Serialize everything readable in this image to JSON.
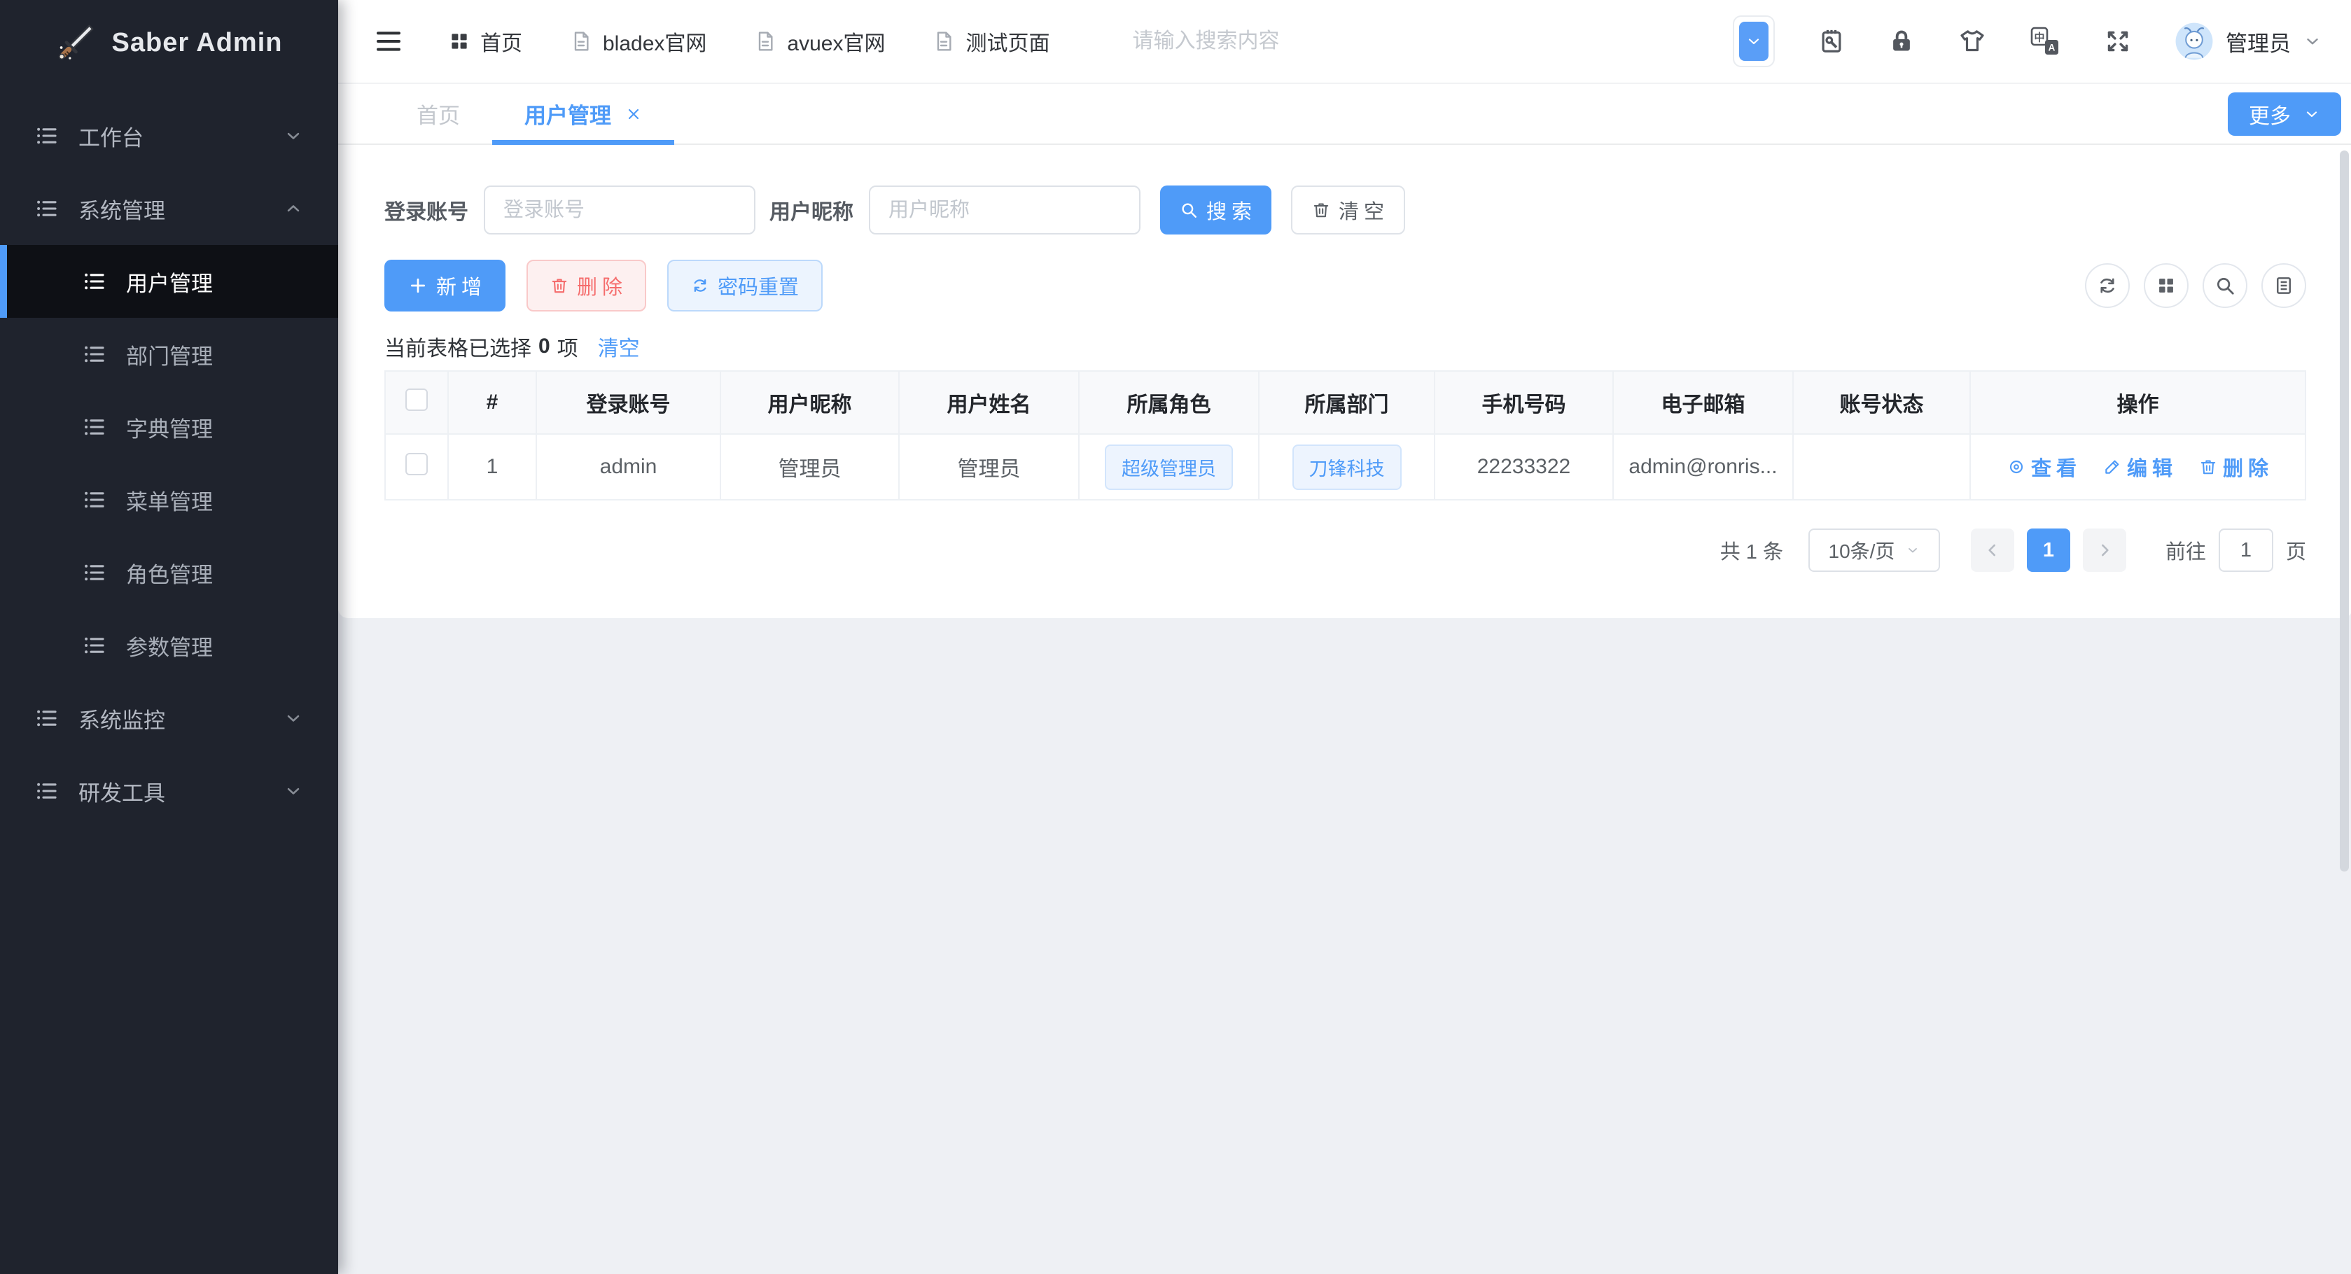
{
  "app": {
    "title": "Saber Admin"
  },
  "sidebar": {
    "groups": [
      {
        "label": "工作台",
        "state": "collapsed"
      },
      {
        "label": "系统管理",
        "state": "expanded",
        "children": [
          {
            "label": "用户管理",
            "active": true
          },
          {
            "label": "部门管理"
          },
          {
            "label": "字典管理"
          },
          {
            "label": "菜单管理"
          },
          {
            "label": "角色管理"
          },
          {
            "label": "参数管理"
          }
        ]
      },
      {
        "label": "系统监控",
        "state": "collapsed"
      },
      {
        "label": "研发工具",
        "state": "collapsed"
      }
    ]
  },
  "header": {
    "nav": [
      {
        "label": "首页",
        "icon": "grid-icon"
      },
      {
        "label": "bladex官网",
        "icon": "document-icon"
      },
      {
        "label": "avuex官网",
        "icon": "document-icon"
      },
      {
        "label": "测试页面",
        "icon": "document-icon"
      }
    ],
    "search_placeholder": "请输入搜索内容",
    "tools": [
      {
        "icon": "collapse-toggle-icon"
      },
      {
        "icon": "devtools-clipboard-icon"
      },
      {
        "icon": "lock-icon"
      },
      {
        "icon": "theme-shirt-icon"
      },
      {
        "icon": "language-icon"
      },
      {
        "icon": "fullscreen-icon"
      }
    ],
    "user": {
      "name": "管理员"
    }
  },
  "tabbar": {
    "tabs": [
      {
        "label": "首页",
        "active": false
      },
      {
        "label": "用户管理",
        "active": true,
        "closable": true
      }
    ],
    "more_label": "更多"
  },
  "filters": {
    "fields": [
      {
        "label": "登录账号",
        "placeholder": "登录账号",
        "value": ""
      },
      {
        "label": "用户昵称",
        "placeholder": "用户昵称",
        "value": ""
      }
    ],
    "search_label": "搜索",
    "clear_label": "清空"
  },
  "toolbar": {
    "add_label": "新增",
    "delete_label": "删除",
    "reset_label": "密码重置",
    "icon_buttons": [
      {
        "icon": "refresh-icon"
      },
      {
        "icon": "grid-icon"
      },
      {
        "icon": "search-icon"
      },
      {
        "icon": "document-lines-icon"
      }
    ]
  },
  "selection": {
    "prefix": "当前表格已选择",
    "count": "0",
    "suffix": "项",
    "clear_label": "清空"
  },
  "table": {
    "columns": [
      "#",
      "登录账号",
      "用户昵称",
      "用户姓名",
      "所属角色",
      "所属部门",
      "手机号码",
      "电子邮箱",
      "账号状态",
      "操作"
    ],
    "rows": [
      {
        "index": "1",
        "account": "admin",
        "nickname": "管理员",
        "realname": "管理员",
        "role": "超级管理员",
        "department": "刀锋科技",
        "phone": "22233322",
        "email": "admin@ronris...",
        "status": "",
        "actions": {
          "view": "查看",
          "edit": "编辑",
          "remove": "删除"
        }
      }
    ]
  },
  "pagination": {
    "total_label": "共 1 条",
    "page_size_label": "10条/页",
    "current_page": "1",
    "goto_label": "前往",
    "goto_value": "1",
    "goto_unit": "页"
  },
  "colors": {
    "accent": "#4f9bf8",
    "danger": "#f56c6c",
    "sidebar_bg": "#1f232d",
    "sidebar_active_bg": "#0e1015",
    "content_bg": "#eef0f4",
    "tag_bg": "#edf4fe",
    "tag_border": "#d2e5fc"
  }
}
